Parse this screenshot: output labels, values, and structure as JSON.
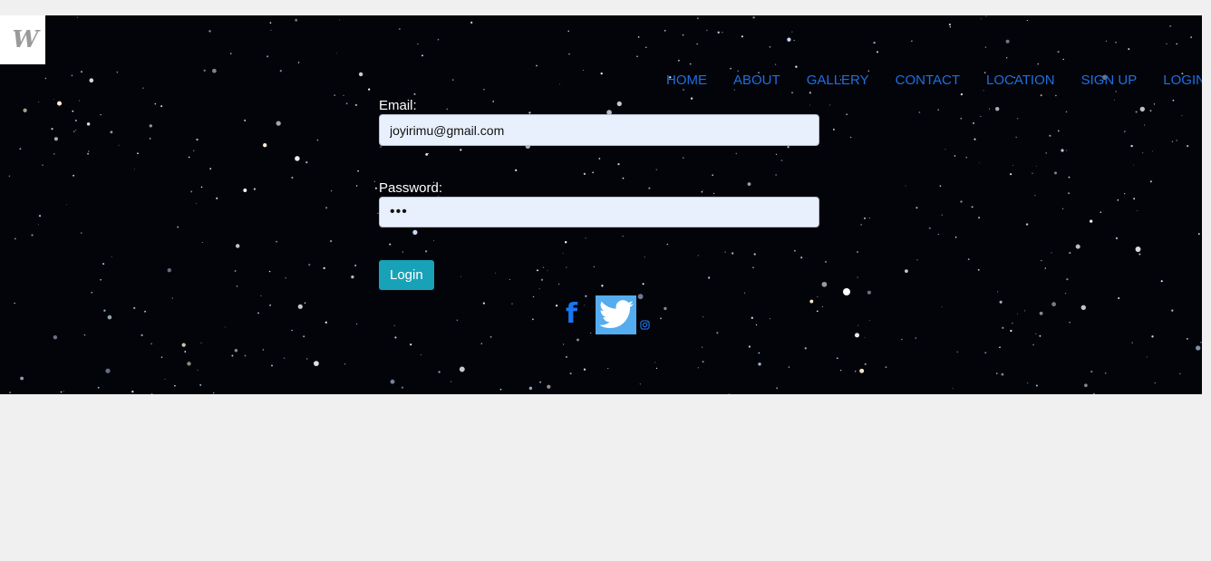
{
  "logo": {
    "text": "W"
  },
  "nav": {
    "items": [
      "HOME",
      "ABOUT",
      "GALLERY",
      "CONTACT",
      "LOCATION",
      "SIGN UP",
      "LOGIN"
    ]
  },
  "form": {
    "email_label": "Email:",
    "email_value": "joyirimu@gmail.com",
    "password_label": "Password:",
    "password_value": "•••",
    "login_button": "Login"
  },
  "social": {
    "facebook": "f"
  },
  "colors": {
    "nav_link": "#1f6fe0",
    "button": "#17a2b8",
    "input_bg": "#e8f0fe",
    "twitter": "#55acee",
    "facebook": "#1877f2"
  }
}
